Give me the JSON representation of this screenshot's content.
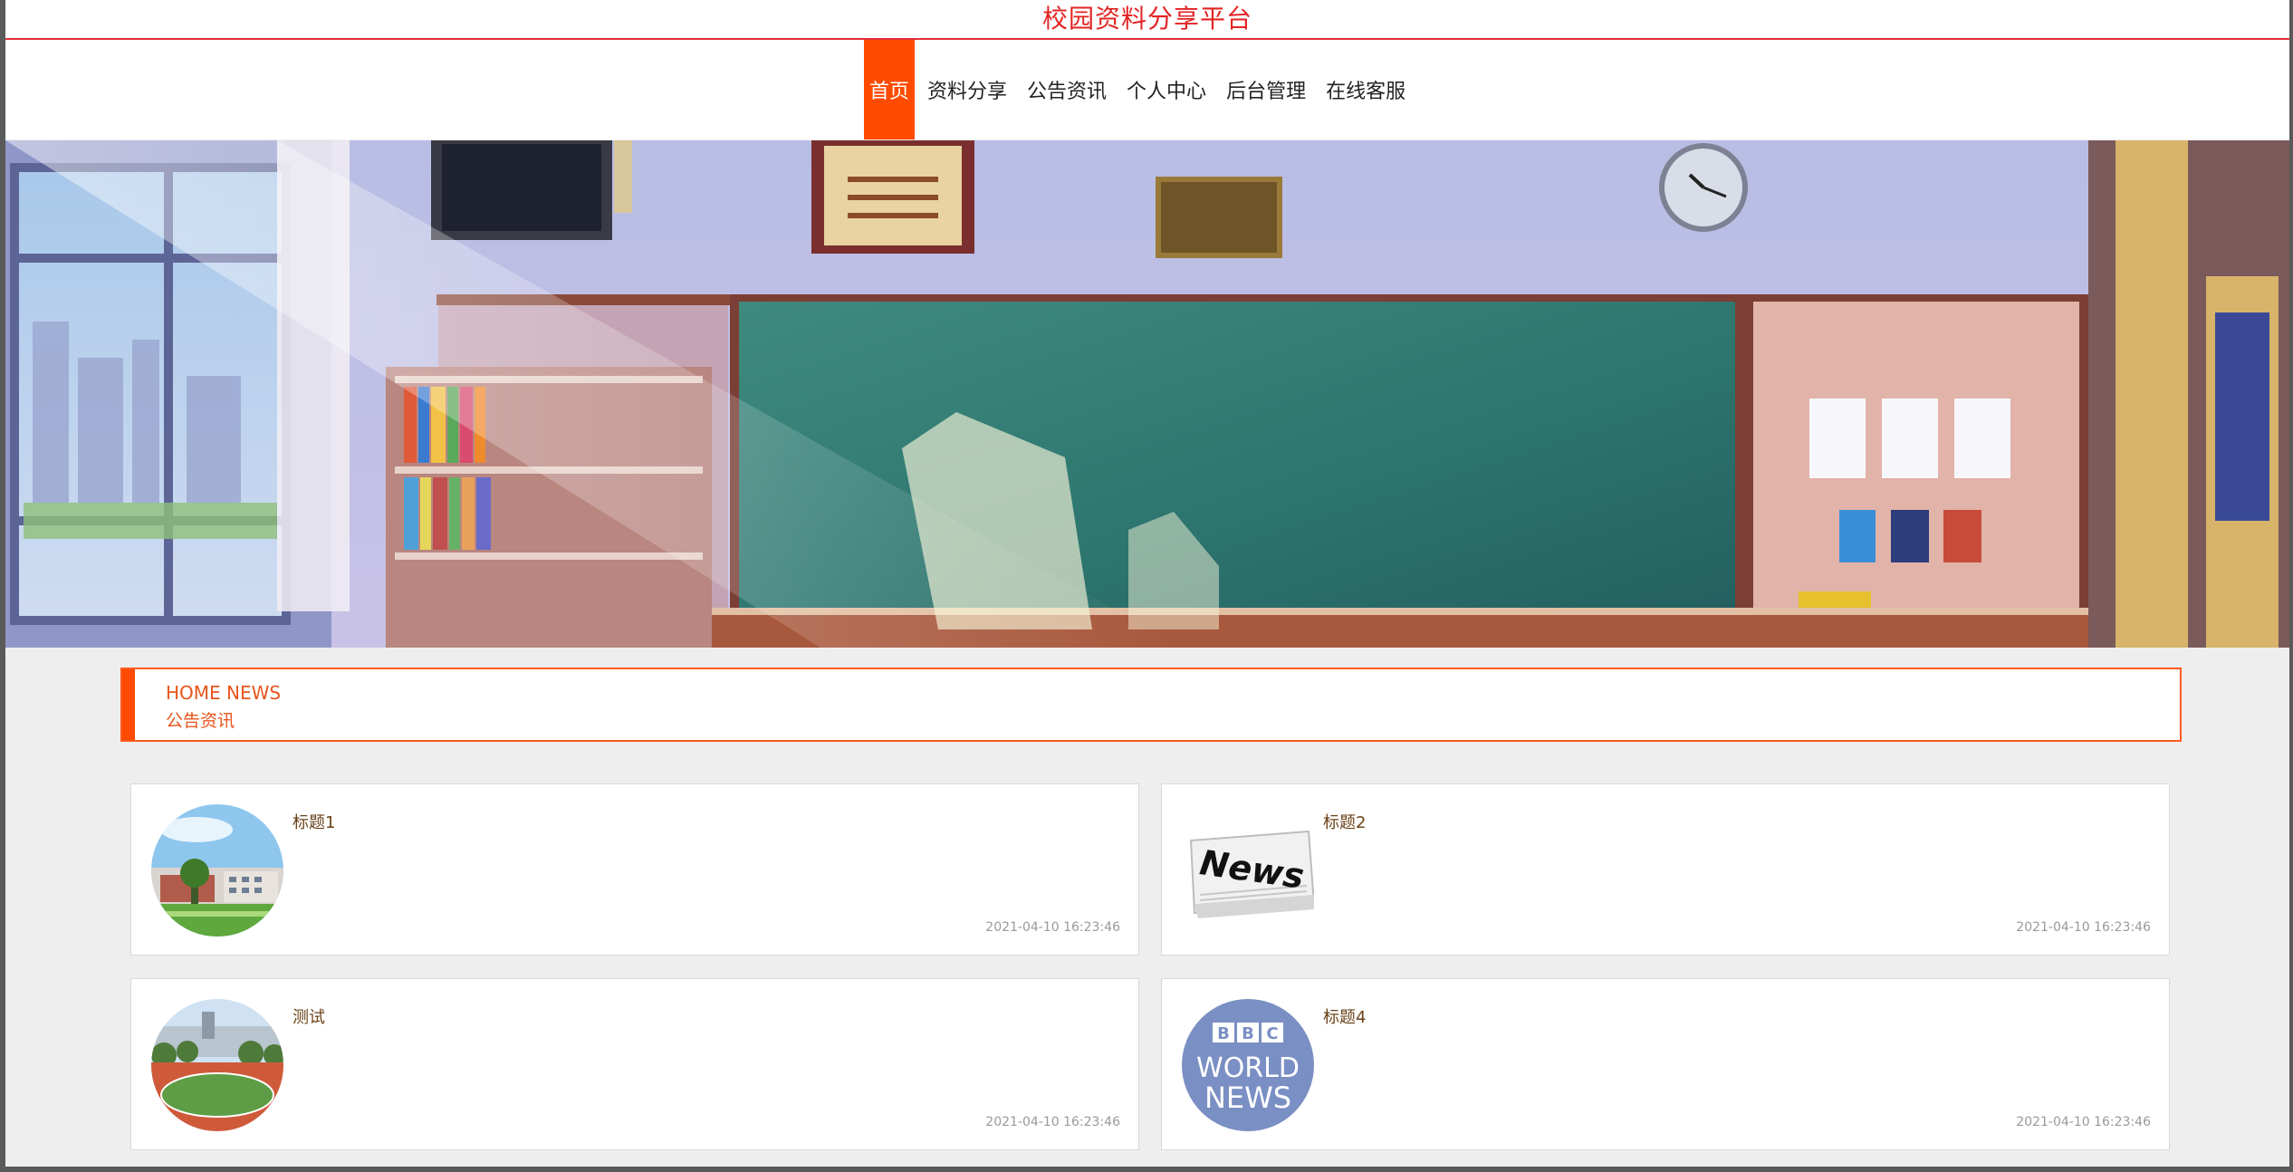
{
  "site": {
    "title": "校园资料分享平台"
  },
  "nav": {
    "items": [
      {
        "label": "首页",
        "active": true
      },
      {
        "label": "资料分享",
        "active": false
      },
      {
        "label": "公告资讯",
        "active": false
      },
      {
        "label": "个人中心",
        "active": false
      },
      {
        "label": "后台管理",
        "active": false
      },
      {
        "label": "在线客服",
        "active": false
      }
    ]
  },
  "section": {
    "title_en": "HOME NEWS",
    "title_cn": "公告资讯"
  },
  "news": [
    {
      "title": "标题1",
      "date": "2021-04-10 16:23:46",
      "image": "campus-building"
    },
    {
      "title": "标题2",
      "date": "2021-04-10 16:23:46",
      "image": "newspaper"
    },
    {
      "title": "测试",
      "date": "2021-04-10 16:23:46",
      "image": "sports-field"
    },
    {
      "title": "标题4",
      "date": "2021-04-10 16:23:46",
      "image": "bbc-world-news-logo"
    }
  ],
  "logo_text": {
    "bbc_letters": [
      "B",
      "B",
      "C"
    ],
    "world": "WORLD",
    "news": "NEWS",
    "newspaper": "News"
  },
  "colors": {
    "accent": "#ff4b00",
    "title_red": "#e32424",
    "background": "#eeeeee"
  }
}
